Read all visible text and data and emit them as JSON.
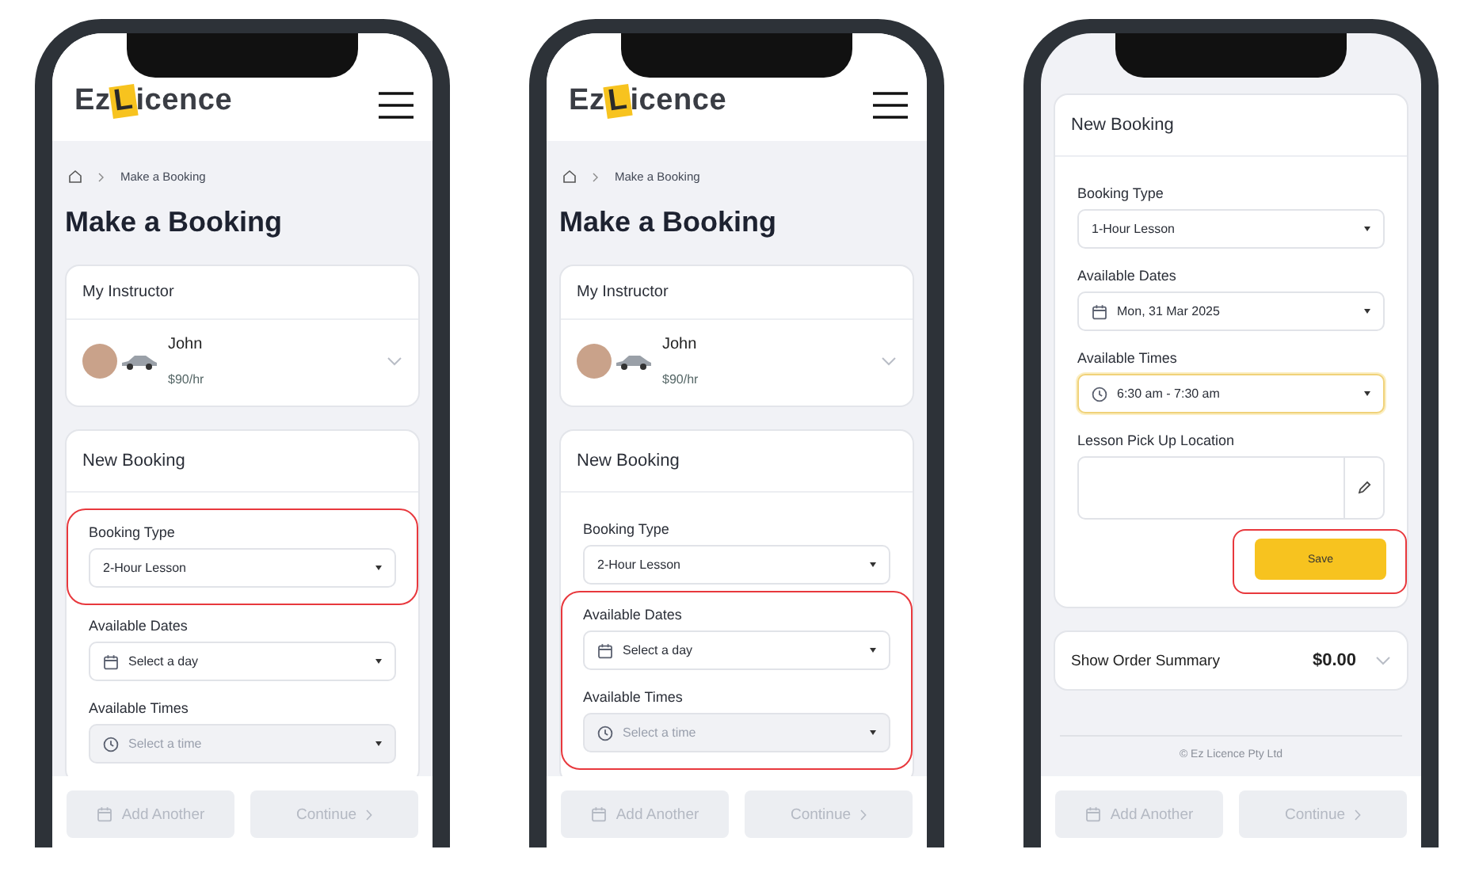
{
  "phones": [
    {
      "header": {
        "logo": [
          "Ez",
          "L",
          "icence"
        ]
      },
      "breadcrumb": "Make a Booking",
      "title": "Make a Booking",
      "instructor": {
        "title": "My Instructor",
        "name": "John",
        "rate": "$90/hr"
      },
      "booking": {
        "title": "New Booking",
        "fields": [
          {
            "label": "Booking Type",
            "kind": "type",
            "value": "2-Hour Lesson",
            "highlighted": true,
            "disabled": false,
            "focused": false
          },
          {
            "label": "Available Dates",
            "kind": "date",
            "placeholder": "Select a day",
            "highlighted": false,
            "disabled": false,
            "focused": false
          },
          {
            "label": "Available Times",
            "kind": "time",
            "placeholder": "Select a time",
            "highlighted": false,
            "disabled": true,
            "focused": false
          }
        ]
      },
      "footer": [
        {
          "kind": "add",
          "label": "Add Another",
          "disabled": true
        },
        {
          "kind": "continue",
          "label": "Continue",
          "disabled": true
        }
      ]
    },
    {
      "header": {
        "logo": [
          "Ez",
          "L",
          "icence"
        ]
      },
      "breadcrumb": "Make a Booking",
      "title": "Make a Booking",
      "instructor": {
        "title": "My Instructor",
        "name": "John",
        "rate": "$90/hr"
      },
      "booking": {
        "title": "New Booking",
        "fields": [
          {
            "label": "Booking Type",
            "kind": "type",
            "value": "2-Hour Lesson",
            "highlighted": false,
            "disabled": false,
            "focused": false
          },
          {
            "label": "Available Dates",
            "kind": "date",
            "placeholder": "Select a day",
            "highlighted": true,
            "disabled": false,
            "focused": false
          },
          {
            "label": "Available Times",
            "kind": "time",
            "placeholder": "Select a time",
            "highlighted": true,
            "disabled": true,
            "focused": false
          }
        ]
      },
      "footer": [
        {
          "kind": "add",
          "label": "Add Another",
          "disabled": true
        },
        {
          "kind": "continue",
          "label": "Continue",
          "disabled": true
        }
      ]
    },
    {
      "booking": {
        "title": "New Booking",
        "fields": [
          {
            "label": "Booking Type",
            "kind": "type",
            "value": "1-Hour Lesson",
            "highlighted": false,
            "disabled": false,
            "focused": false
          },
          {
            "label": "Available Dates",
            "kind": "date",
            "value": "Mon, 31 Mar 2025",
            "highlighted": false,
            "disabled": false,
            "focused": false
          },
          {
            "label": "Available Times",
            "kind": "time",
            "value": "6:30 am - 7:30 am",
            "highlighted": false,
            "disabled": false,
            "focused": true
          },
          {
            "label": "Lesson Pick Up Location",
            "kind": "location",
            "highlighted": false,
            "disabled": false,
            "focused": false
          }
        ],
        "save": {
          "label": "Save",
          "highlighted": true
        }
      },
      "order_summary": {
        "label": "Show Order Summary",
        "amount": "$0.00"
      },
      "copyright": "© Ez Licence Pty Ltd",
      "footer": [
        {
          "kind": "add",
          "label": "Add Another",
          "disabled": true
        },
        {
          "kind": "continue",
          "label": "Continue",
          "disabled": true
        }
      ]
    }
  ]
}
